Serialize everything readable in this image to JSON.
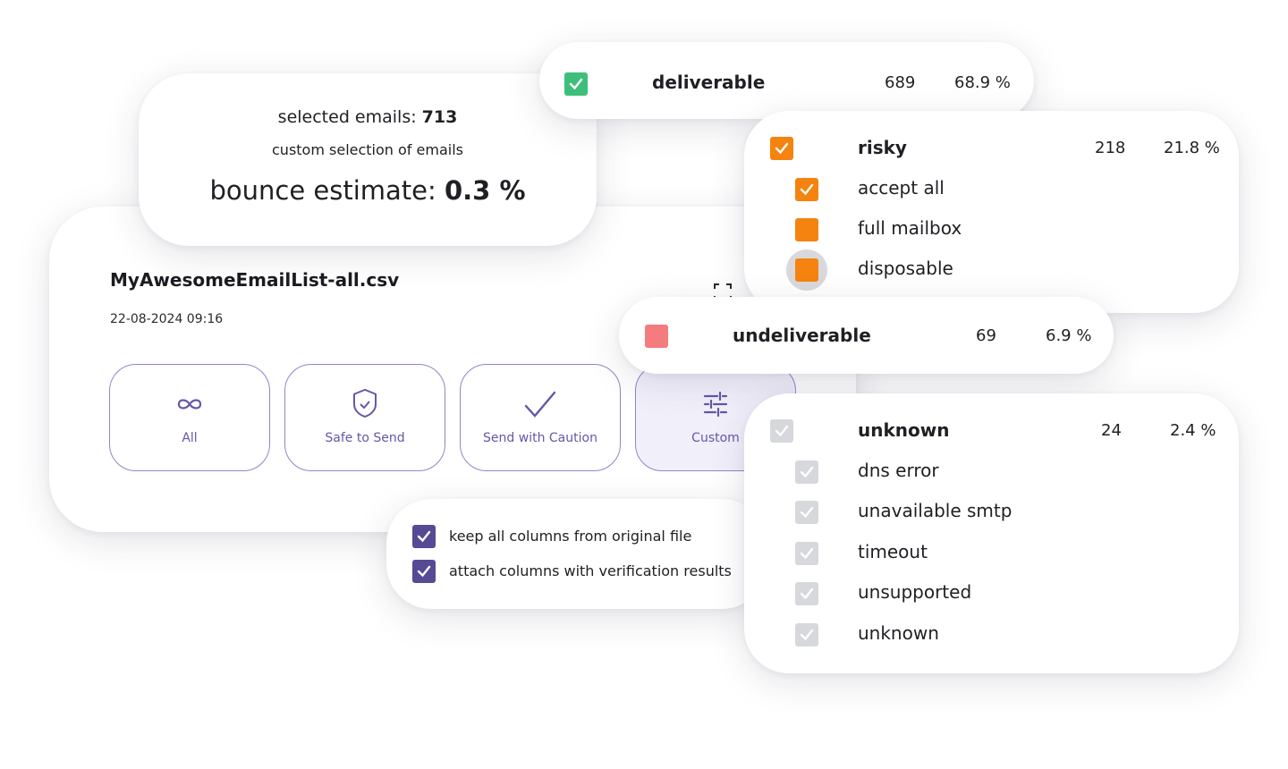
{
  "estimate": {
    "selected_prefix": "selected emails: ",
    "selected_count": "713",
    "selection_type": "custom selection of emails",
    "bounce_prefix": "bounce estimate: ",
    "bounce_value": "0.3 %"
  },
  "file": {
    "name": "MyAwesomeEmailList-all.csv",
    "date": "22-08-2024 09:16"
  },
  "filters": [
    {
      "label": "All",
      "icon": "infinity-icon"
    },
    {
      "label": "Safe to Send",
      "icon": "shield-check-icon"
    },
    {
      "label": "Send with Caution",
      "icon": "checkmark-icon"
    },
    {
      "label": "Custom",
      "icon": "sliders-icon",
      "active": true
    }
  ],
  "deliverable": {
    "label": "deliverable",
    "count": "689",
    "percent": "68.9 %",
    "color": "#3dbf7a"
  },
  "risky": {
    "label": "risky",
    "count": "218",
    "percent": "21.8 %",
    "color": "#f5830f",
    "subs": [
      {
        "label": "accept all",
        "checked": true
      },
      {
        "label": "full mailbox",
        "checked": false
      },
      {
        "label": "disposable",
        "checked": false
      }
    ]
  },
  "undeliverable": {
    "label": "undeliverable",
    "count": "69",
    "percent": "6.9 %",
    "color": "#f47b7e"
  },
  "unknown": {
    "label": "unknown",
    "count": "24",
    "percent": "2.4 %",
    "color": "#d6d8dc",
    "subs": [
      {
        "label": "dns error"
      },
      {
        "label": "unavailable smtp"
      },
      {
        "label": "timeout"
      },
      {
        "label": "unsupported"
      },
      {
        "label": "unknown"
      }
    ]
  },
  "columns": {
    "keep_label": "keep all columns from original file",
    "attach_label": "attach columns with verification results",
    "color": "#574a94"
  }
}
